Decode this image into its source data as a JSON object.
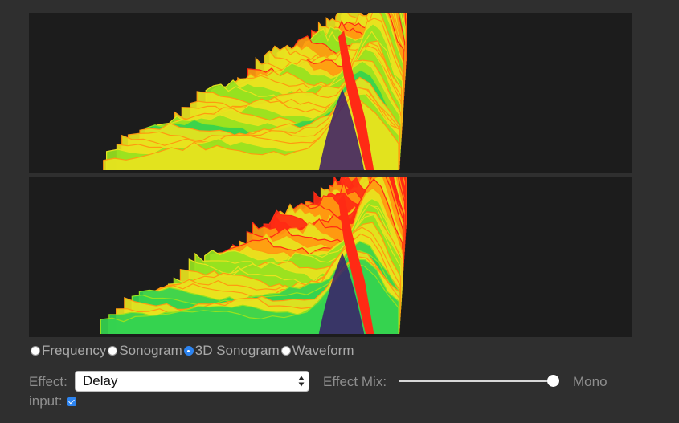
{
  "visualizer": {
    "palette": [
      "#3a1a6b",
      "#2b3cc0",
      "#1aa8c8",
      "#34d24f",
      "#96e21f",
      "#e8e31e",
      "#ff9a10",
      "#ff2a14"
    ],
    "background": "#1c1c1c"
  },
  "view_modes": [
    {
      "label": "Frequency",
      "checked": false
    },
    {
      "label": "Sonogram",
      "checked": false
    },
    {
      "label": "3D Sonogram",
      "checked": true
    },
    {
      "label": "Waveform",
      "checked": false
    }
  ],
  "controls": {
    "effect_label": "Effect:",
    "effect_selected": "Delay",
    "mix_label": "Effect Mix:",
    "mix_value": 1.0,
    "mono_label": "Mono",
    "input_label": "input:",
    "mono_checked": true
  }
}
